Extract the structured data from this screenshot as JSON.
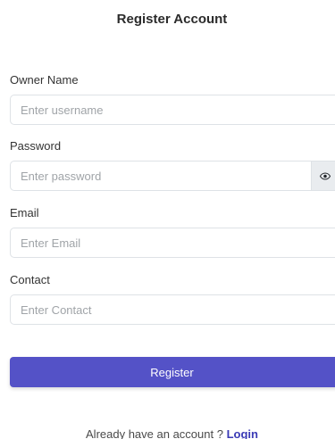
{
  "header": {
    "title": "Register Account"
  },
  "form": {
    "owner_name": {
      "label": "Owner Name",
      "placeholder": "Enter username",
      "value": ""
    },
    "password": {
      "label": "Password",
      "placeholder": "Enter password",
      "value": "",
      "toggle_icon": "eye-icon"
    },
    "email": {
      "label": "Email",
      "placeholder": "Enter Email",
      "value": ""
    },
    "contact": {
      "label": "Contact",
      "placeholder": "Enter Contact",
      "value": ""
    },
    "submit_label": "Register"
  },
  "footer": {
    "prompt": "Already have an account ?",
    "login_label": "Login"
  },
  "colors": {
    "primary": "#5452c7",
    "link": "#3a3ab5",
    "border": "#dee2e6"
  }
}
